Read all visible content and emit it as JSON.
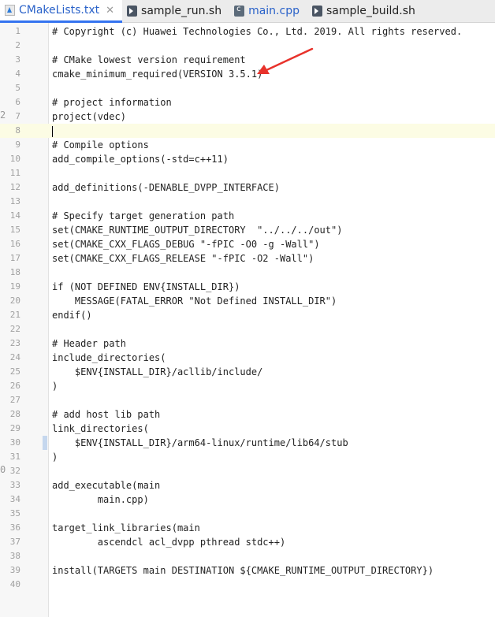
{
  "tabs": [
    {
      "label": "CMakeLists.txt",
      "icon": "cmake-file-icon",
      "active": true,
      "closable": true
    },
    {
      "label": "sample_run.sh",
      "icon": "shell-file-icon",
      "active": false,
      "closable": false
    },
    {
      "label": "main.cpp",
      "icon": "cpp-file-icon",
      "active": false,
      "closable": false
    },
    {
      "label": "sample_build.sh",
      "icon": "shell-file-icon",
      "active": false,
      "closable": false
    }
  ],
  "close_symbol": "✕",
  "side_digits": [
    "2",
    "0"
  ],
  "editor": {
    "current_line": 8,
    "lines": [
      "# Copyright (c) Huawei Technologies Co., Ltd. 2019. All rights reserved.",
      "",
      "# CMake lowest version requirement",
      "cmake_minimum_required(VERSION 3.5.1)",
      "",
      "# project information",
      "project(vdec)",
      "",
      "# Compile options",
      "add_compile_options(-std=c++11)",
      "",
      "add_definitions(-DENABLE_DVPP_INTERFACE)",
      "",
      "# Specify target generation path",
      "set(CMAKE_RUNTIME_OUTPUT_DIRECTORY  \"../../../out\")",
      "set(CMAKE_CXX_FLAGS_DEBUG \"-fPIC -O0 -g -Wall\")",
      "set(CMAKE_CXX_FLAGS_RELEASE \"-fPIC -O2 -Wall\")",
      "",
      "if (NOT DEFINED ENV{INSTALL_DIR})",
      "    MESSAGE(FATAL_ERROR \"Not Defined INSTALL_DIR\")",
      "endif()",
      "",
      "# Header path",
      "include_directories(",
      "    $ENV{INSTALL_DIR}/acllib/include/",
      ")",
      "",
      "# add host lib path",
      "link_directories(",
      "    $ENV{INSTALL_DIR}/arm64-linux/runtime/lib64/stub",
      ")",
      "",
      "add_executable(main",
      "        main.cpp)",
      "",
      "target_link_libraries(main",
      "        ascendcl acl_dvpp pthread stdc++)",
      "",
      "install(TARGETS main DESTINATION ${CMAKE_RUNTIME_OUTPUT_DIRECTORY})",
      ""
    ]
  },
  "annotation": {
    "type": "red-arrow",
    "color": "#e8322b",
    "points_to_line": 4
  },
  "colors": {
    "active_tab_text": "#2a62c9",
    "current_line_bg": "#fcfce4",
    "line_number": "#a0a0a0"
  }
}
